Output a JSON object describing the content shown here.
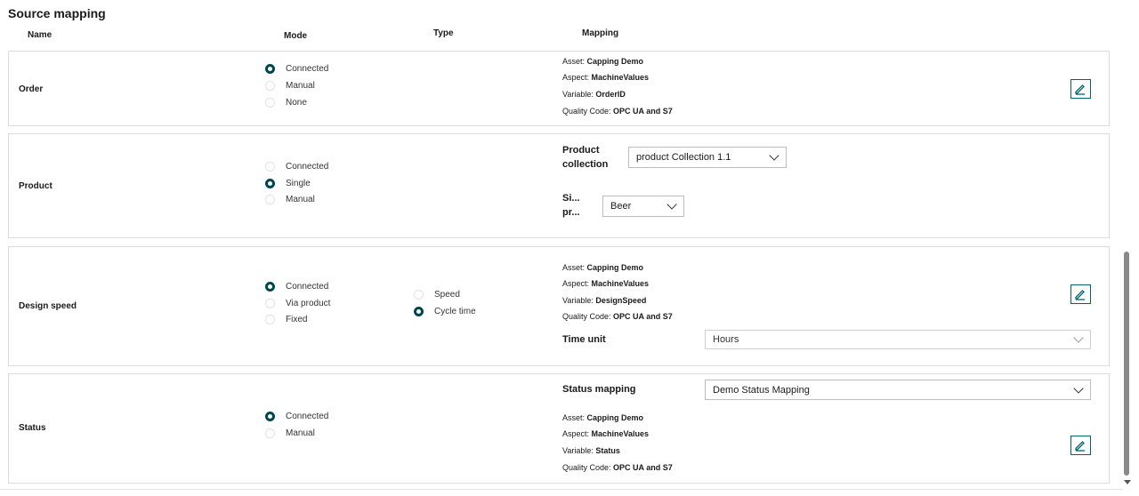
{
  "section": {
    "title": "Source mapping"
  },
  "columns": {
    "name": "Name",
    "mode": "Mode",
    "type": "Type",
    "mapping": "Mapping"
  },
  "rows": {
    "order": {
      "name": "Order",
      "modes": [
        {
          "label": "Connected",
          "selected": true
        },
        {
          "label": "Manual",
          "selected": false
        },
        {
          "label": "None",
          "selected": false
        }
      ],
      "mapping": [
        {
          "key": "Asset: ",
          "value": "Capping Demo"
        },
        {
          "key": "Aspect: ",
          "value": "MachineValues"
        },
        {
          "key": "Variable: ",
          "value": "OrderID"
        },
        {
          "key": "Quality Code: ",
          "value": "OPC UA and S7"
        }
      ]
    },
    "product": {
      "name": "Product",
      "modes": [
        {
          "label": "Connected",
          "selected": false
        },
        {
          "label": "Single",
          "selected": true
        },
        {
          "label": "Manual",
          "selected": false
        }
      ],
      "collection_label": "Product collection",
      "collection_value": "product Collection 1.1",
      "single_label": "Si... pr...",
      "single_value": "Beer"
    },
    "design_speed": {
      "name": "Design speed",
      "modes": [
        {
          "label": "Connected",
          "selected": true
        },
        {
          "label": "Via product",
          "selected": false
        },
        {
          "label": "Fixed",
          "selected": false
        }
      ],
      "types": [
        {
          "label": "Speed",
          "selected": false
        },
        {
          "label": "Cycle time",
          "selected": true
        }
      ],
      "mapping": [
        {
          "key": "Asset: ",
          "value": "Capping Demo"
        },
        {
          "key": "Aspect: ",
          "value": "MachineValues"
        },
        {
          "key": "Variable: ",
          "value": "DesignSpeed"
        },
        {
          "key": "Quality Code: ",
          "value": "OPC UA and S7"
        }
      ],
      "time_unit_label": "Time unit",
      "time_unit_value": "Hours"
    },
    "status": {
      "name": "Status",
      "modes": [
        {
          "label": "Connected",
          "selected": true
        },
        {
          "label": "Manual",
          "selected": false
        }
      ],
      "status_mapping_label": "Status mapping",
      "status_mapping_value": "Demo Status Mapping",
      "mapping": [
        {
          "key": "Asset: ",
          "value": "Capping Demo"
        },
        {
          "key": "Aspect: ",
          "value": "MachineValues"
        },
        {
          "key": "Variable: ",
          "value": "Status"
        },
        {
          "key": "Quality Code: ",
          "value": "OPC UA and S7"
        }
      ]
    }
  },
  "icons": {
    "edit": "edit-pencil-icon",
    "dropdown": "chevron-down-icon"
  },
  "colors": {
    "accent": "#00464f",
    "edit_border": "#00646e",
    "border": "#dcdcdc"
  }
}
